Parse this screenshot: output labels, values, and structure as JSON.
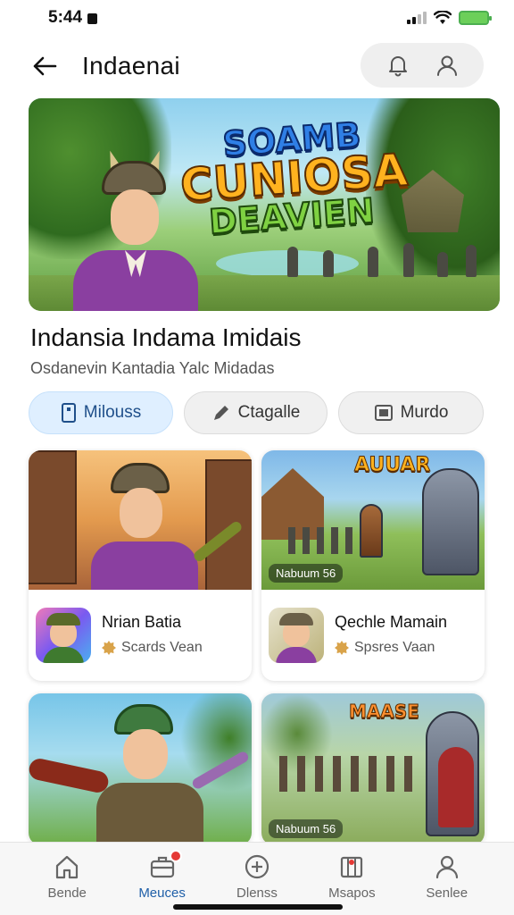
{
  "status_bar": {
    "time": "5:44"
  },
  "header": {
    "title": "Indaenai"
  },
  "hero": {
    "logo_line1": "SOAMB",
    "logo_line2": "CUNIOSA",
    "logo_line3": "DEAVIEN"
  },
  "game": {
    "title": "Indansia Indama Imidais",
    "subtitle": "Osdanevin Kantadia Yalc Midadas"
  },
  "actions": [
    {
      "label": "Milouss",
      "icon": "phone-icon"
    },
    {
      "label": "Ctagalle",
      "icon": "pencil-icon"
    },
    {
      "label": "Murdo",
      "icon": "image-icon"
    }
  ],
  "cards": [
    {
      "name": "Nrian Batia",
      "sub": "Scards Vean",
      "caption": ""
    },
    {
      "name": "Qechle Mamain",
      "sub": "Spsres Vaan",
      "caption": "Nabuum 56",
      "badge": "AUUAR"
    },
    {
      "name": "",
      "sub": "",
      "caption": ""
    },
    {
      "name": "",
      "sub": "",
      "caption": "Nabuum 56",
      "badge": "MAASE"
    }
  ],
  "bottom_nav": [
    {
      "label": "Bende",
      "icon": "home-icon",
      "active": false
    },
    {
      "label": "Meuces",
      "icon": "briefcase-icon",
      "active": true,
      "badge": true
    },
    {
      "label": "Dlenss",
      "icon": "plus-circle-icon",
      "active": false
    },
    {
      "label": "Msapos",
      "icon": "map-icon",
      "active": false
    },
    {
      "label": "Senlee",
      "icon": "profile-icon",
      "active": false
    }
  ],
  "colors": {
    "accent": "#1f5fa8",
    "primary_button_bg": "#dfefff",
    "badge": "#e53935",
    "battery": "#6ccf5a"
  }
}
